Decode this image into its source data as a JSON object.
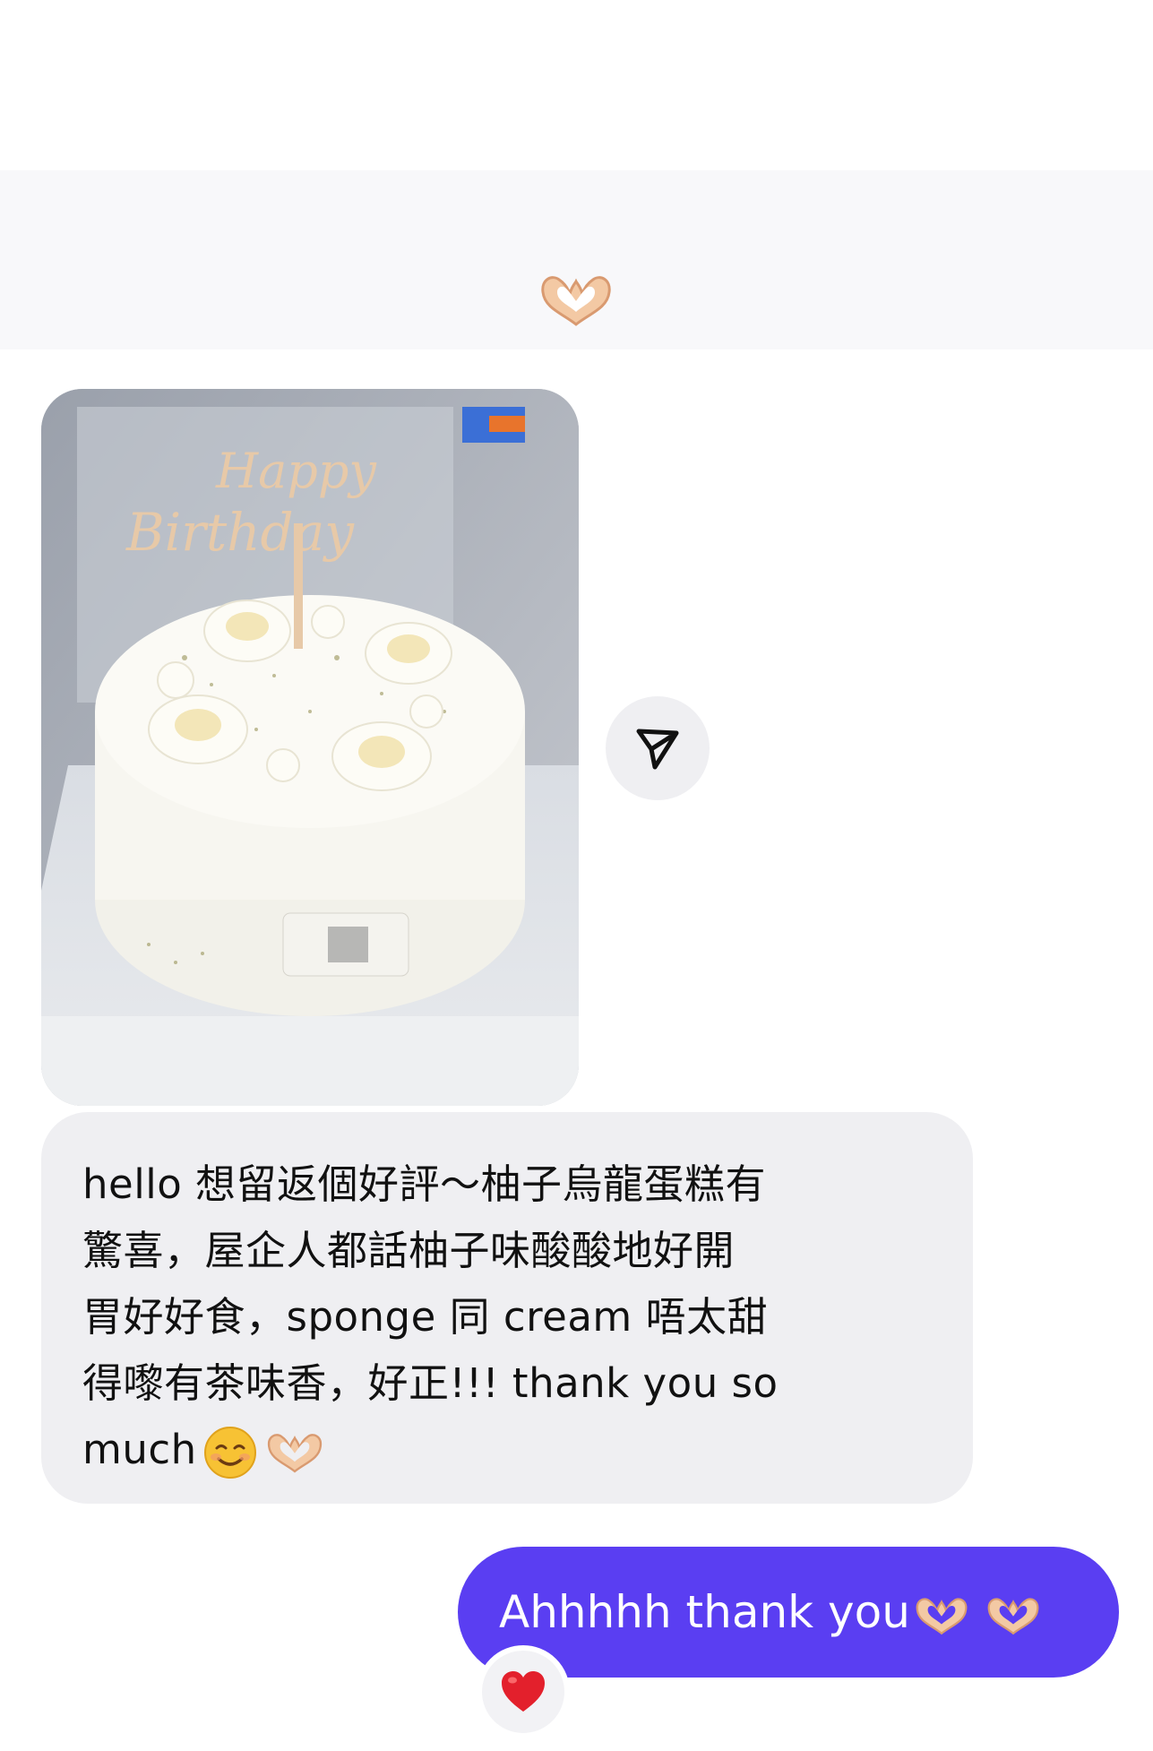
{
  "reaction": {
    "icon": "heart-hands-emoji"
  },
  "incoming_photo": {
    "topper_text": "Happy Birthday",
    "description": "cake-photo"
  },
  "share_button": {
    "icon": "send-icon"
  },
  "incoming_message": {
    "lines": [
      "hello 想留返個好評～柚子烏龍蛋糕有",
      "驚喜，屋企人都話柚子味酸酸地好開",
      "胃好好食，sponge 同 cream 唔太甜",
      "得嚟有茶味香，好正!!! thank you so",
      "much"
    ],
    "emojis": [
      "smiling-face-emoji",
      "heart-hands-emoji"
    ]
  },
  "outgoing_message": {
    "text": "Ahhhhh thank you",
    "emojis": [
      "heart-hands-emoji",
      "heart-hands-emoji"
    ]
  },
  "message_reaction": {
    "icon": "red-heart-emoji"
  },
  "colors": {
    "outgoing_bubble": "#5a3ef2",
    "incoming_bubble": "#efeff2",
    "background": "#ffffff"
  }
}
